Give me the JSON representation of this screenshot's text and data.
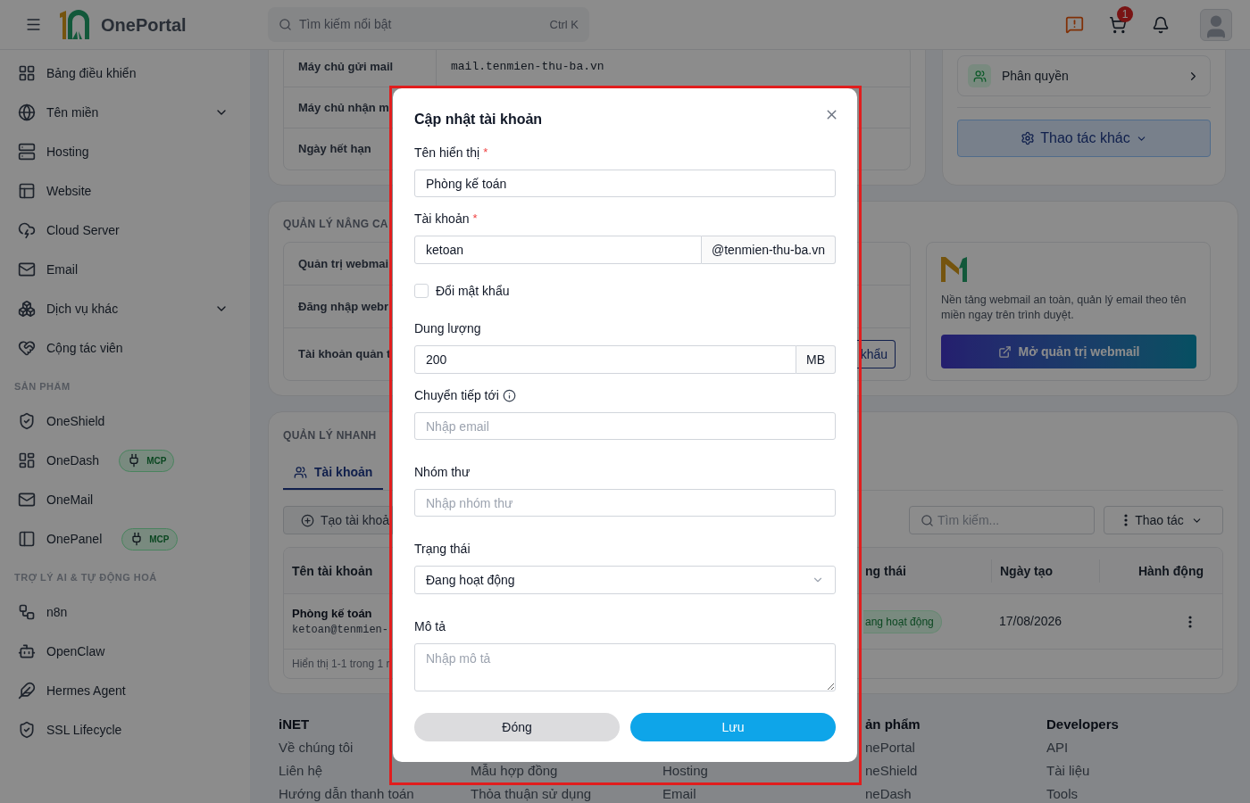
{
  "header": {
    "brand": "OnePortal",
    "search": {
      "placeholder": "Tìm kiếm nổi bật",
      "shortcut": "Ctrl K"
    },
    "cart_count": "1"
  },
  "sidebar": {
    "groups": [
      {
        "items": [
          {
            "label": "Bảng điều khiển",
            "expandable": false
          },
          {
            "label": "Tên miền",
            "expandable": true
          },
          {
            "label": "Hosting",
            "expandable": false
          },
          {
            "label": "Website",
            "expandable": false
          },
          {
            "label": "Cloud Server",
            "expandable": false
          },
          {
            "label": "Email",
            "expandable": false
          },
          {
            "label": "Dịch vụ khác",
            "expandable": true
          },
          {
            "label": "Cộng tác viên",
            "expandable": false
          }
        ]
      },
      {
        "heading": "SẢN PHẨM",
        "items": [
          {
            "label": "OneShield",
            "expandable": false
          },
          {
            "label": "OneDash",
            "expandable": false,
            "badge": "MCP"
          },
          {
            "label": "OneMail",
            "expandable": false
          },
          {
            "label": "OnePanel",
            "expandable": false,
            "badge": "MCP"
          }
        ]
      },
      {
        "heading": "TRỢ LÝ AI & TỰ ĐỘNG HOÁ",
        "items": [
          {
            "label": "n8n",
            "expandable": false
          },
          {
            "label": "OpenClaw",
            "expandable": false
          },
          {
            "label": "Hermes Agent",
            "expandable": false
          },
          {
            "label": "SSL Lifecycle",
            "expandable": false
          }
        ]
      }
    ]
  },
  "info_card": {
    "rows": [
      {
        "label": "Máy chủ gửi mail",
        "value": "mail.tenmien-thu-ba.vn"
      },
      {
        "label": "Máy chủ nhận m"
      },
      {
        "label": "Ngày hết hạn"
      }
    ]
  },
  "side_card": {
    "link": "Phân quyền",
    "more_button": "Thao tác khác"
  },
  "advanced": {
    "title": "QUẢN LÝ NÂNG CA",
    "rows": [
      {
        "label": "Quản trị webmai"
      },
      {
        "label": "Đăng nhập webr"
      },
      {
        "label": "Tài khoản quản t",
        "button": "khẩu"
      }
    ],
    "webmail": {
      "description": "Nền tảng webmail an toàn, quản lý email theo tên miền ngay trên trình duyệt.",
      "button": "Mở quản trị webmail"
    }
  },
  "quick": {
    "title": "QUẢN LÝ NHANH",
    "tabs": [
      {
        "label": "Tài khoản",
        "selected": true
      }
    ],
    "create_button": "Tạo tài khoả",
    "search_placeholder": "Tìm kiếm...",
    "actions_button": "Thao tác",
    "table": {
      "columns": [
        "Tên tài khoản",
        "ng thái",
        "Ngày tạo",
        "Hành động"
      ],
      "rows": [
        {
          "name": "Phòng kế toán",
          "email": "ketoan@tenmien-",
          "status": "ang hoạt động",
          "created": "17/08/2026"
        }
      ],
      "footer": "Hiển thị 1-1 trong 1 r"
    }
  },
  "footer": {
    "columns": [
      {
        "heading": "iNET",
        "links": [
          "Về chúng tôi",
          "Liên hệ",
          "Hướng dẫn thanh toán"
        ]
      },
      {
        "links": [
          "Mẫu hợp đồng",
          "Thỏa thuận sử dụng"
        ]
      },
      {
        "links": [
          "Hosting",
          "Email"
        ]
      },
      {
        "heading": "ản phẩm",
        "links": [
          "nePortal",
          "neShield",
          "neDash"
        ]
      },
      {
        "heading": "Developers",
        "links": [
          "API",
          "Tài liệu",
          "Tools"
        ]
      }
    ]
  },
  "modal": {
    "highlighted": true,
    "title": "Cập nhật tài khoản",
    "required_mark": "*",
    "fields": [
      {
        "kind": "text",
        "label": "Tên hiển thị",
        "required": true,
        "value": "Phòng kế toán"
      },
      {
        "kind": "addon",
        "label": "Tài khoản",
        "required": true,
        "value": "ketoan",
        "addon": "@tenmien-thu-ba.vn"
      },
      {
        "kind": "checkbox",
        "label": "Đổi mật khẩu",
        "required": false,
        "checked": false
      },
      {
        "kind": "addon",
        "label": "Dung lượng",
        "required": false,
        "value": "200",
        "addon": "MB"
      },
      {
        "kind": "text",
        "label": "Chuyển tiếp tới",
        "required": false,
        "info": true,
        "placeholder": "Nhập email"
      },
      {
        "kind": "text",
        "label": "Nhóm thư",
        "required": false,
        "placeholder": "Nhập nhóm thư"
      },
      {
        "kind": "select",
        "label": "Trạng thái",
        "required": false,
        "value": "Đang hoạt động"
      },
      {
        "kind": "textarea",
        "label": "Mô tả",
        "required": false,
        "placeholder": "Nhập mô tả"
      }
    ],
    "buttons": [
      "Đóng",
      "Lưu"
    ]
  }
}
